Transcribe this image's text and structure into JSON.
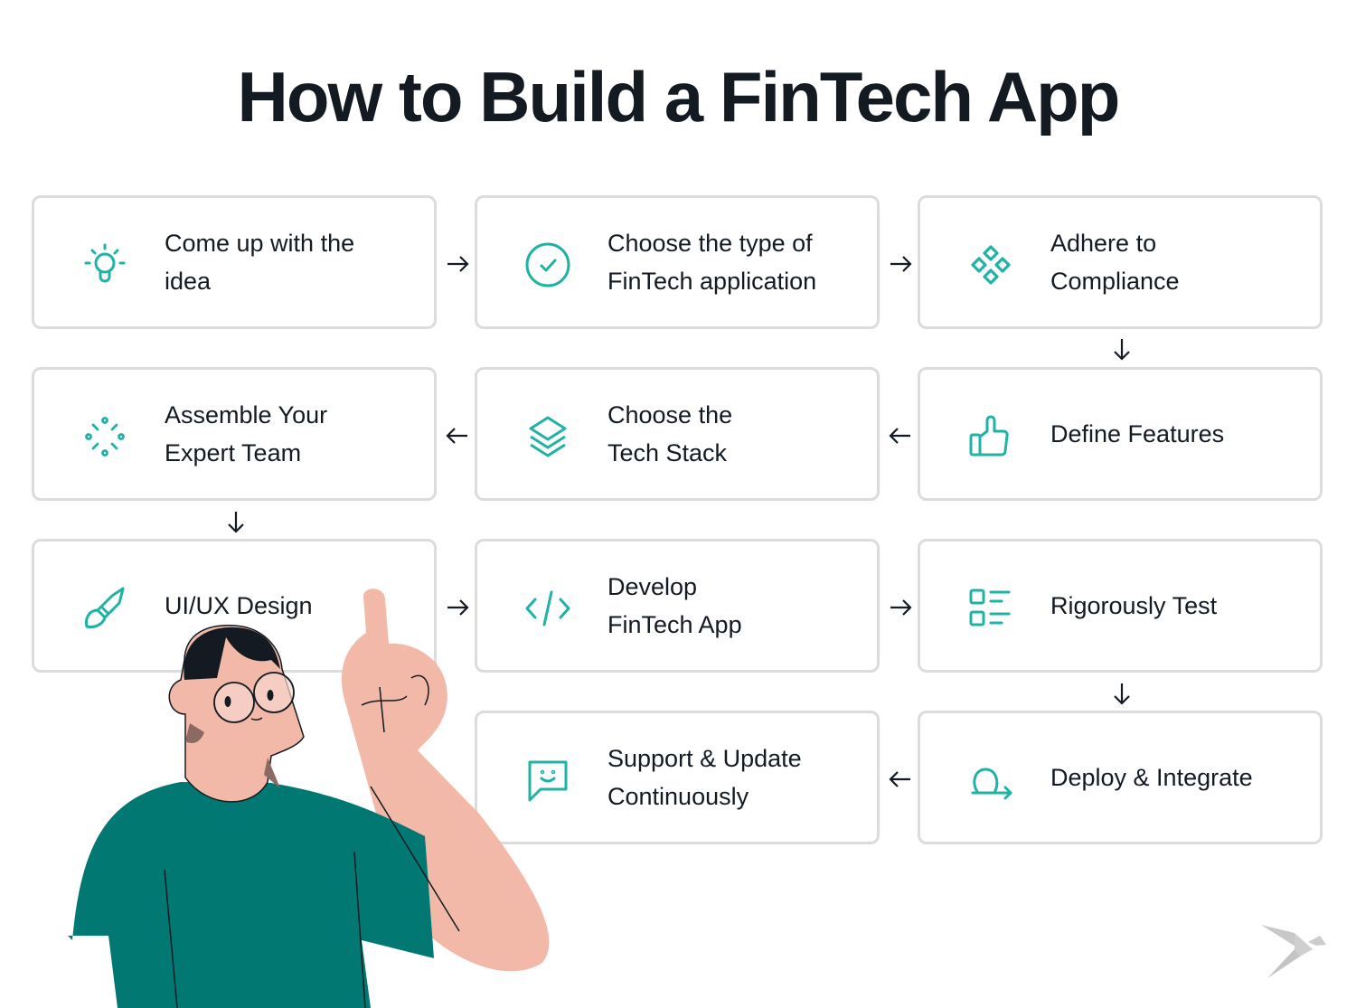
{
  "title": "How to Build a FinTech App",
  "colors": {
    "accent": "#1fb3a6",
    "text": "#131a22",
    "border": "#dcdcdc",
    "shirt": "#027872",
    "skin": "#f2b9a8"
  },
  "steps": [
    {
      "icon": "lightbulb-icon",
      "line1": "Come up with the",
      "line2": "idea"
    },
    {
      "icon": "check-circle-icon",
      "line1": "Choose the type of",
      "line2": "FinTech application"
    },
    {
      "icon": "diamonds-icon",
      "line1": "Adhere to",
      "line2": "Compliance"
    },
    {
      "icon": "thumbs-up-icon",
      "line1": "Define Features",
      "line2": ""
    },
    {
      "icon": "layers-icon",
      "line1": "Choose the",
      "line2": "Tech Stack"
    },
    {
      "icon": "team-burst-icon",
      "line1": "Assemble Your",
      "line2": "Expert Team"
    },
    {
      "icon": "paintbrush-icon",
      "line1": "UI/UX Design",
      "line2": ""
    },
    {
      "icon": "code-icon",
      "line1": "Develop",
      "line2": "FinTech App"
    },
    {
      "icon": "checklist-icon",
      "line1": "Rigorously Test",
      "line2": ""
    },
    {
      "icon": "deploy-loop-icon",
      "line1": "Deploy & Integrate",
      "line2": ""
    },
    {
      "icon": "chat-smile-icon",
      "line1": "Support & Update",
      "line2": "Continuously"
    }
  ],
  "flow_arrows": [
    "right",
    "right",
    "down",
    "left",
    "left",
    "down",
    "right",
    "right",
    "down",
    "left"
  ]
}
